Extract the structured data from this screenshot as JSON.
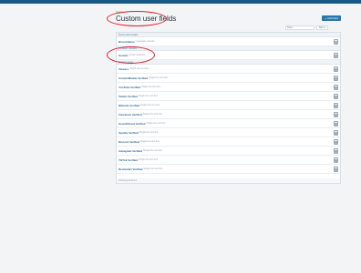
{
  "breadcrumb": "Users",
  "page_title": "Custom user fields",
  "add_button": {
    "label": "Add field",
    "icon": "plus-icon"
  },
  "filter": {
    "placeholder": "Filter...",
    "button": "Sort"
  },
  "groups": [
    {
      "title": "Personal details",
      "rows": [
        {
          "name": "Brand Name",
          "hint": "Legendary website"
        }
      ]
    },
    {
      "title": "Contact details",
      "rows": [
        {
          "name": "Socials",
          "hint": "Social networks"
        }
      ]
    },
    {
      "title": "Preferences",
      "rows": [
        {
          "name": "Viewers",
          "hint": "Single line text box"
        },
        {
          "name": "CreatorMarket Verified",
          "hint": "Single line text box"
        },
        {
          "name": "YouTube Verified",
          "hint": "Single line text box"
        },
        {
          "name": "Twitch Verified",
          "hint": "Single line text box"
        },
        {
          "name": "Website Verified",
          "hint": "Single line text box"
        },
        {
          "name": "Facebook Verified",
          "hint": "Single line text box"
        },
        {
          "name": "SoundCloud Verified",
          "hint": "Single line text box"
        },
        {
          "name": "Spotify Verified",
          "hint": "Single line text box"
        },
        {
          "name": "Discord Verified",
          "hint": "Single line text box"
        },
        {
          "name": "Instagram Verified",
          "hint": "Single line text box"
        },
        {
          "name": "TikTok Verified",
          "hint": "Single line text box"
        },
        {
          "name": "Deviantart Verified",
          "hint": "Single line text box"
        }
      ]
    }
  ],
  "footer": "Showing all items"
}
